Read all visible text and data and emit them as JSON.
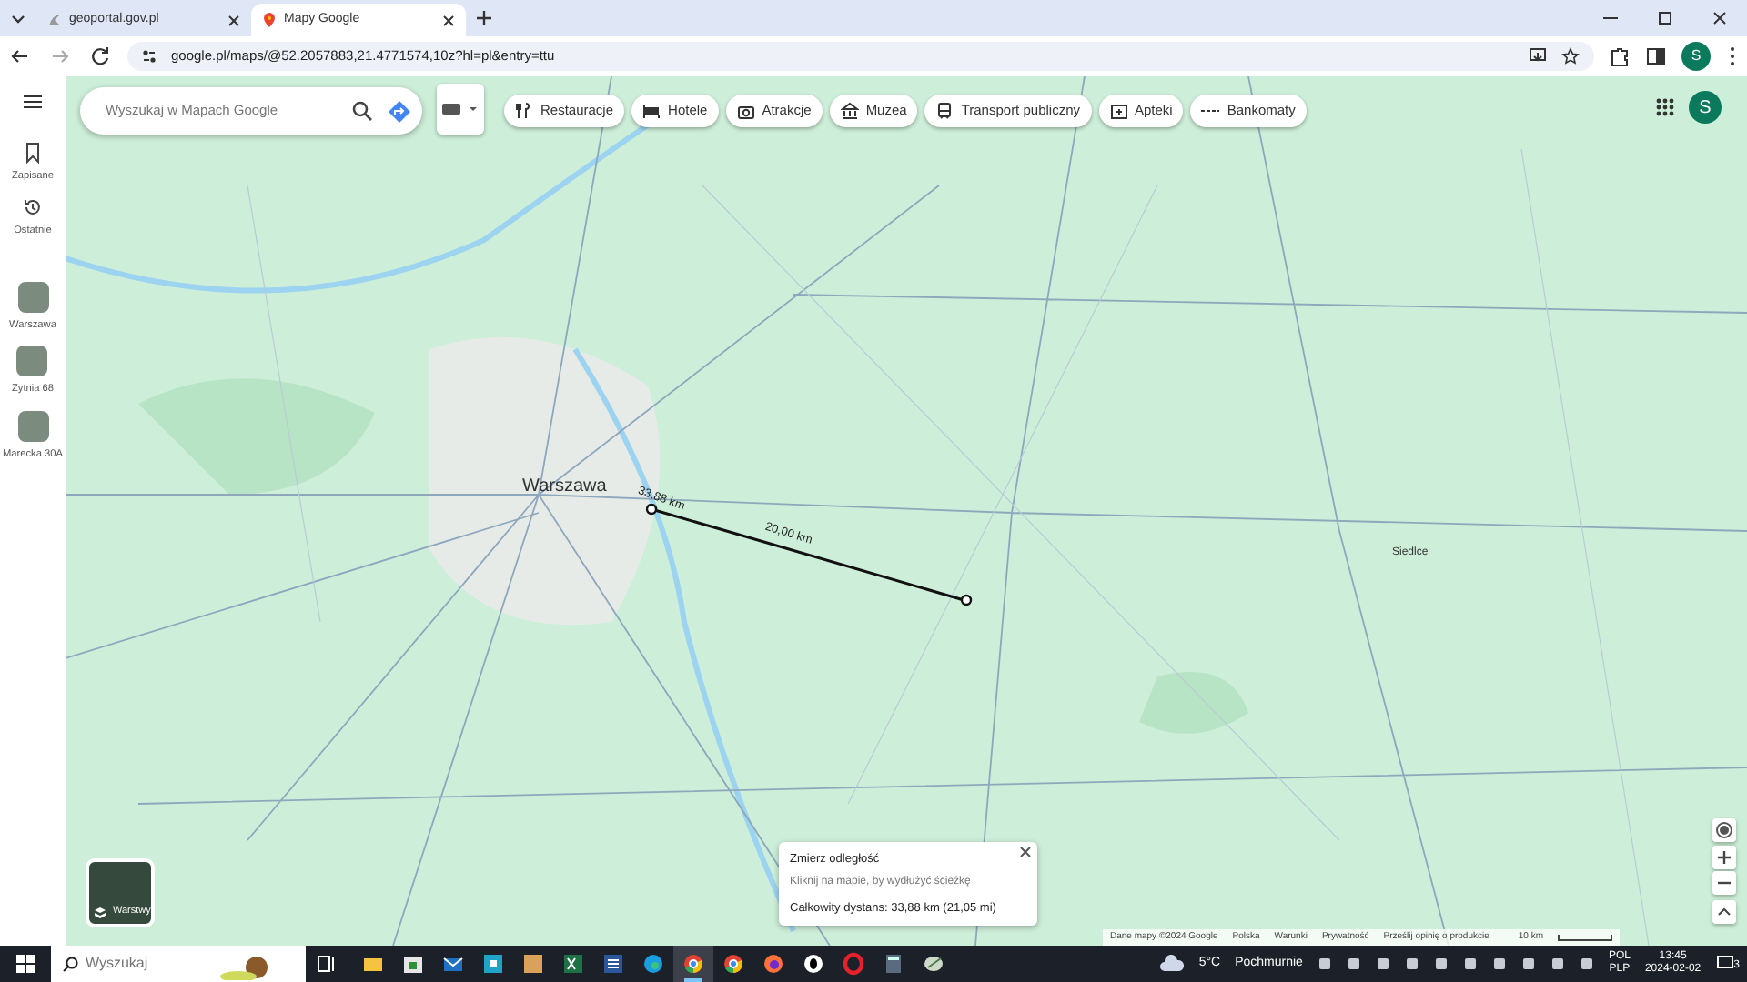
{
  "browser": {
    "tabs": [
      {
        "title": "geoportal.gov.pl",
        "selected": false
      },
      {
        "title": "Mapy Google",
        "selected": true
      }
    ],
    "url": "google.pl/maps/@52.2057883,21.4771574,10z?hl=pl&entry=ttu",
    "profile_initial": "S"
  },
  "sidebar": {
    "items": [
      {
        "label": "Zapisane",
        "kind": "saved"
      },
      {
        "label": "Ostatnie",
        "kind": "recent"
      },
      {
        "label": "Warszawa",
        "kind": "place"
      },
      {
        "label": "Żytnia 68",
        "kind": "place"
      },
      {
        "label": "Marecka 30A",
        "kind": "place"
      }
    ]
  },
  "search": {
    "placeholder": "Wyszukaj w Mapach Google"
  },
  "chips": [
    {
      "label": "Restauracje",
      "kind": "restaurant"
    },
    {
      "label": "Hotele",
      "kind": "hotel"
    },
    {
      "label": "Atrakcje",
      "kind": "camera"
    },
    {
      "label": "Muzea",
      "kind": "museum"
    },
    {
      "label": "Transport publiczny",
      "kind": "transit"
    },
    {
      "label": "Apteki",
      "kind": "pharmacy"
    },
    {
      "label": "Bankomaty",
      "kind": "atm"
    }
  ],
  "account_initial": "S",
  "map": {
    "places": [
      {
        "label": "Warszawa",
        "kind": "city"
      },
      {
        "label": "Siedlce",
        "kind": "town"
      }
    ],
    "measure_labels": [
      "33,88 km",
      "20,00 km"
    ]
  },
  "layers_button": {
    "label": "Warstwy"
  },
  "measure_card": {
    "title": "Zmierz odległość",
    "hint": "Kliknij na mapie, by wydłużyć ścieżkę",
    "total": "Całkowity dystans: 33,88 km (21,05 mi)"
  },
  "attribution": [
    "Dane mapy ©2024 Google",
    "Polska",
    "Warunki",
    "Prywatność",
    "Prześlij opinię o produkcie"
  ],
  "scale": "10 km",
  "taskbar": {
    "search_placeholder": "Wyszukaj",
    "apps": [
      {
        "kind": "taskview",
        "selected": false
      },
      {
        "kind": "folder",
        "selected": false
      },
      {
        "kind": "store",
        "selected": false
      },
      {
        "kind": "mail",
        "selected": false
      },
      {
        "kind": "square",
        "selected": false
      },
      {
        "kind": "media",
        "selected": false
      },
      {
        "kind": "sheet",
        "selected": false
      },
      {
        "kind": "doc",
        "selected": false
      },
      {
        "kind": "edge",
        "selected": false
      },
      {
        "kind": "chrome",
        "selected": true
      },
      {
        "kind": "chrome",
        "selected": false
      },
      {
        "kind": "firefox",
        "selected": false
      },
      {
        "kind": "ring",
        "selected": false
      },
      {
        "kind": "opera",
        "selected": false
      },
      {
        "kind": "calculator",
        "selected": false
      },
      {
        "kind": "bird",
        "selected": false
      }
    ],
    "temperature": "5°C",
    "weather": "Pochmurnie",
    "languages": [
      "POL",
      "PLP"
    ],
    "time": "13:45",
    "date": "2024-02-02",
    "notifications": "3"
  }
}
